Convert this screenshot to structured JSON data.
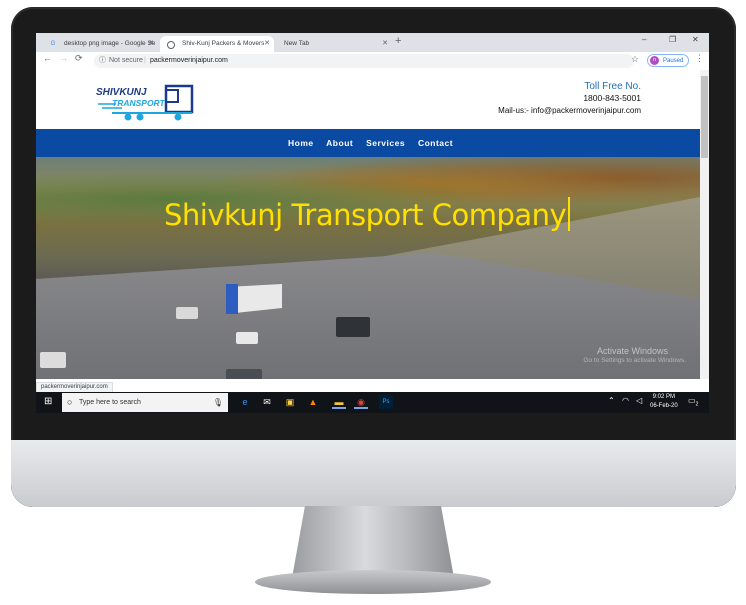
{
  "browser": {
    "tabs": [
      {
        "title": "desktop png image - Google Se",
        "icon": "google-icon"
      },
      {
        "title": "Shiv-Kunj Packers & Movers",
        "icon": "globe-icon",
        "active": true
      },
      {
        "title": "New Tab",
        "icon": ""
      }
    ],
    "new_tab": "+",
    "window_controls": {
      "minimize": "–",
      "restore": "❐",
      "close": "✕"
    },
    "nav": {
      "back": "←",
      "forward": "→",
      "reload": "⟳"
    },
    "address": {
      "security": "Not secure",
      "separator": "|",
      "url": "packermoverinjaipur.com"
    },
    "profile": {
      "initial": "n",
      "label": "Paused"
    },
    "star": "☆",
    "menu": "⋮",
    "status_url": "packermoverinjaipur.com"
  },
  "site": {
    "logo": {
      "line1": "SHIVKUNJ",
      "line2": "TRANSPORT"
    },
    "contact": {
      "toll_free_label": "Toll Free No.",
      "phone": "1800-843-5001",
      "mail": "Mail-us:- info@packermoverinjaipur.com"
    },
    "nav": [
      "Home",
      "About",
      "Services",
      "Contact"
    ],
    "hero_title": "Shivkunj Transport Company",
    "watermark": {
      "line1": "Activate Windows",
      "line2": "Go to Settings to activate Windows."
    }
  },
  "taskbar": {
    "search_placeholder": "Type here to search",
    "time": "9:02 PM",
    "date": "06-Feb-20",
    "notification_count": "2"
  },
  "colors": {
    "nav_blue": "#0b4aa2",
    "toll_blue": "#1f6fb8",
    "hero_yellow": "#ffe000",
    "logo_blue": "#1d3a8a",
    "logo_cyan": "#1fa6e0"
  }
}
